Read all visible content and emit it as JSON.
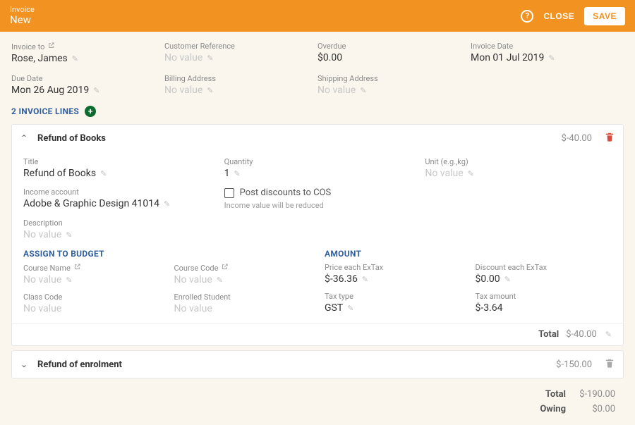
{
  "header": {
    "label": "Invoice",
    "status": "New",
    "close_label": "CLOSE",
    "save_label": "SAVE"
  },
  "summary": {
    "invoice_to": {
      "label": "Invoice to",
      "value": "Rose, James"
    },
    "customer_ref": {
      "label": "Customer Reference",
      "value": "No value"
    },
    "overdue": {
      "label": "Overdue",
      "value": "$0.00"
    },
    "invoice_date": {
      "label": "Invoice Date",
      "value": "Mon 01 Jul 2019"
    },
    "due_date": {
      "label": "Due Date",
      "value": "Mon 26 Aug 2019"
    },
    "billing_address": {
      "label": "Billing Address",
      "value": "No value"
    },
    "shipping_address": {
      "label": "Shipping Address",
      "value": "No value"
    }
  },
  "lines_header": "2 INVOICE LINES",
  "line1": {
    "title": "Refund of Books",
    "amount": "$-40.00",
    "fields": {
      "title": {
        "label": "Title",
        "value": "Refund of Books"
      },
      "quantity": {
        "label": "Quantity",
        "value": "1"
      },
      "unit": {
        "label": "Unit (e.g.,kg)",
        "value": "No value"
      },
      "income_account": {
        "label": "Income account",
        "value": "Adobe & Graphic Design 41014"
      },
      "checkbox_label": "Post discounts to COS",
      "checkbox_hint": "Income value will be reduced",
      "description": {
        "label": "Description",
        "value": "No value"
      }
    },
    "budget_header": "ASSIGN TO BUDGET",
    "budget": {
      "course_name": {
        "label": "Course Name",
        "value": "No value"
      },
      "course_code": {
        "label": "Course Code",
        "value": "No value"
      },
      "class_code": {
        "label": "Class Code",
        "value": "No value"
      },
      "enrolled_student": {
        "label": "Enrolled Student",
        "value": "No value"
      }
    },
    "amount_header": "AMOUNT",
    "pricing": {
      "price_each": {
        "label": "Price each ExTax",
        "value": "$-36.36"
      },
      "discount_each": {
        "label": "Discount each ExTax",
        "value": "$0.00"
      },
      "tax_type": {
        "label": "Tax type",
        "value": "GST"
      },
      "tax_amount": {
        "label": "Tax amount",
        "value": "$-3.64"
      }
    },
    "total_label": "Total",
    "total_value": "$-40.00"
  },
  "line2": {
    "title": "Refund of enrolment",
    "amount": "$-150.00"
  },
  "grand": {
    "total_label": "Total",
    "total_value": "$-190.00",
    "owing_label": "Owing",
    "owing_value": "$0.00"
  }
}
